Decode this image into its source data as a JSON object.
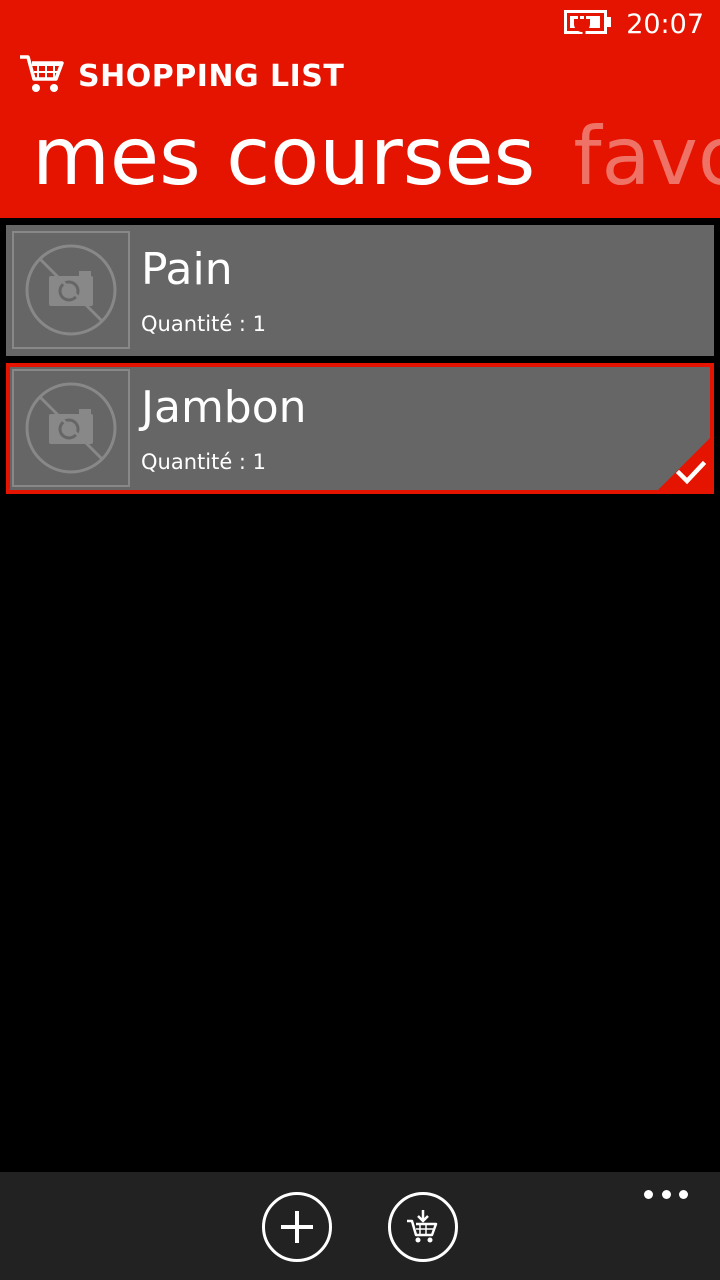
{
  "status_bar": {
    "time": "20:07",
    "battery_icon": "battery-charging-icon"
  },
  "app": {
    "title": "SHOPPING LIST",
    "logo_icon": "shopping-cart-icon",
    "accent": "#e51400"
  },
  "pivot": {
    "tabs": [
      {
        "label": "mes courses",
        "active": true
      },
      {
        "label": "favor",
        "active": false
      }
    ]
  },
  "items": [
    {
      "name": "Pain",
      "quantity": "Quantité : 1",
      "image_icon": "no-photo-icon",
      "selected": false
    },
    {
      "name": "Jambon",
      "quantity": "Quantité : 1",
      "image_icon": "no-photo-icon",
      "selected": true
    }
  ],
  "app_bar": {
    "buttons": [
      {
        "icon": "add-icon"
      },
      {
        "icon": "cart-download-icon"
      }
    ],
    "more_icon": "more-dots-icon"
  }
}
